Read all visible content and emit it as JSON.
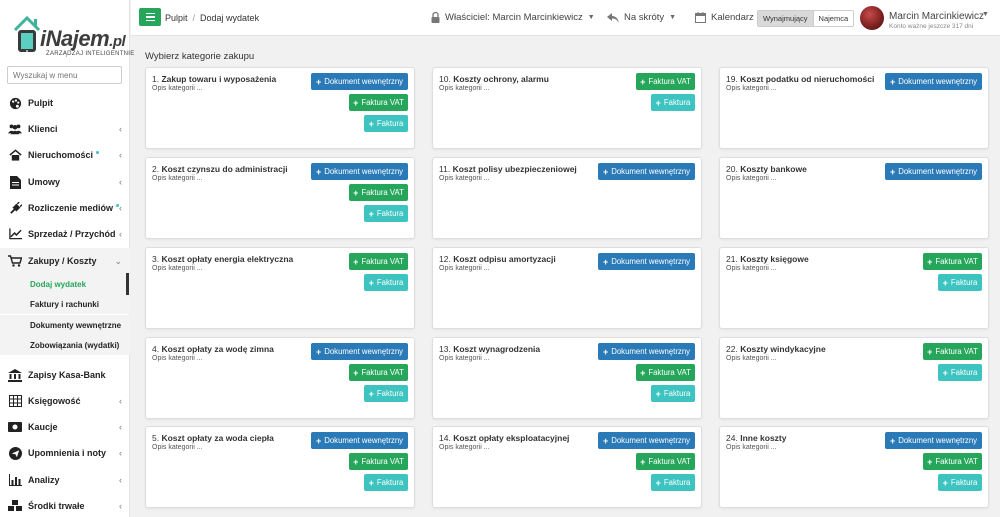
{
  "logo": {
    "name": "iNajem",
    "suffix": ".pl",
    "tagline": "ZARZĄDZAJ INTELIGENTNIE"
  },
  "sidebar": {
    "search_placeholder": "Wyszukaj w menu",
    "items": [
      {
        "label": "Pulpit",
        "icon": "palette-icon",
        "chevron": false
      },
      {
        "label": "Klienci",
        "icon": "users-icon",
        "chevron": true
      },
      {
        "label": "Nieruchomości",
        "icon": "home-icon",
        "chevron": true,
        "dot": true
      },
      {
        "label": "Umowy",
        "icon": "document-icon",
        "chevron": true
      },
      {
        "label": "Rozliczenie mediów",
        "icon": "plug-icon",
        "chevron": true,
        "dot": true
      },
      {
        "label": "Sprzedaż / Przychód",
        "icon": "line-chart-icon",
        "chevron": true
      },
      {
        "label": "Zakupy / Koszty",
        "icon": "cart-icon",
        "chevron": true,
        "expanded": true
      }
    ],
    "subitems": [
      {
        "label": "Dodaj wydatek",
        "active": true
      },
      {
        "label": "Faktury i rachunki"
      },
      {
        "label": "Dokumenty wewnętrzne"
      },
      {
        "label": "Zobowiązania (wydatki)"
      }
    ],
    "items_after": [
      {
        "label": "Zapisy Kasa-Bank",
        "icon": "bank-icon",
        "chevron": false
      },
      {
        "label": "Księgowość",
        "icon": "table-icon",
        "chevron": true
      },
      {
        "label": "Kaucje",
        "icon": "money-icon",
        "chevron": true
      },
      {
        "label": "Upomnienia i noty",
        "icon": "send-icon",
        "chevron": true
      },
      {
        "label": "Analizy",
        "icon": "bar-chart-icon",
        "chevron": true
      },
      {
        "label": "Środki trwałe",
        "icon": "cubes-icon",
        "chevron": true
      }
    ]
  },
  "header": {
    "breadcrumb": [
      "Pulpit",
      "Dodaj wydatek"
    ],
    "owner": "Właściciel: Marcin Marcinkiewicz",
    "shortcuts": "Na skróty",
    "calendar": "Kalendarz",
    "role_toggle": {
      "active": "Wynajmujący",
      "inactive": "Najemca"
    },
    "user_name": "Marcin Marcinkiewicz",
    "user_sub": "Konto ważne jeszcze 317 dni"
  },
  "main": {
    "title": "Wybierz kategorie zakupu",
    "button_labels": {
      "dok": "Dokument wewnętrzny",
      "vat": "Faktura VAT",
      "fak": "Faktura"
    },
    "categories": [
      {
        "num": "1.",
        "name": "Zakup towaru i wyposażenia",
        "desc": "Opis kategorii ...",
        "buttons": [
          "dok",
          "vat",
          "fak"
        ]
      },
      {
        "num": "2.",
        "name": "Koszt czynszu do administracji",
        "desc": "Opis kategorii ...",
        "buttons": [
          "dok",
          "vat",
          "fak"
        ]
      },
      {
        "num": "3.",
        "name": "Koszt opłaty energia elektryczna",
        "desc": "Opis kategorii ...",
        "buttons": [
          "vat",
          "fak"
        ]
      },
      {
        "num": "4.",
        "name": "Koszt opłaty za wodę zimna",
        "desc": "Opis kategorii ...",
        "buttons": [
          "dok",
          "vat",
          "fak"
        ]
      },
      {
        "num": "5.",
        "name": "Koszt opłaty za woda ciepła",
        "desc": "Opis kategorii ...",
        "buttons": [
          "dok",
          "vat",
          "fak"
        ]
      },
      {
        "num": "10.",
        "name": "Koszty ochrony, alarmu",
        "desc": "Opis kategorii ...",
        "buttons": [
          "vat",
          "fak"
        ]
      },
      {
        "num": "11.",
        "name": "Koszt polisy ubezpieczeniowej",
        "desc": "Opis kategorii ...",
        "buttons": [
          "dok"
        ]
      },
      {
        "num": "12.",
        "name": "Koszt odpisu amortyzacji",
        "desc": "Opis kategorii ...",
        "buttons": [
          "dok"
        ]
      },
      {
        "num": "13.",
        "name": "Koszt wynagrodzenia",
        "desc": "Opis kategorii ...",
        "buttons": [
          "dok",
          "vat",
          "fak"
        ]
      },
      {
        "num": "14.",
        "name": "Koszt opłaty eksploatacyjnej",
        "desc": "Opis kategorii ...",
        "buttons": [
          "dok",
          "vat",
          "fak"
        ]
      },
      {
        "num": "19.",
        "name": "Koszt podatku od nieruchomości",
        "desc": "Opis kategorii ...",
        "buttons": [
          "dok"
        ]
      },
      {
        "num": "20.",
        "name": "Koszty bankowe",
        "desc": "Opis kategorii ...",
        "buttons": [
          "dok"
        ]
      },
      {
        "num": "21.",
        "name": "Koszty księgowe",
        "desc": "Opis kategorii ...",
        "buttons": [
          "vat",
          "fak"
        ]
      },
      {
        "num": "22.",
        "name": "Koszty windykacyjne",
        "desc": "Opis kategorii ...",
        "buttons": [
          "vat",
          "fak"
        ]
      },
      {
        "num": "24.",
        "name": "Inne koszty",
        "desc": "Opis kategorii ...",
        "buttons": [
          "dok",
          "vat",
          "fak"
        ]
      }
    ]
  },
  "colors": {
    "green": "#26a65b",
    "blue": "#2a7ab8",
    "teal": "#3ec4c0"
  }
}
